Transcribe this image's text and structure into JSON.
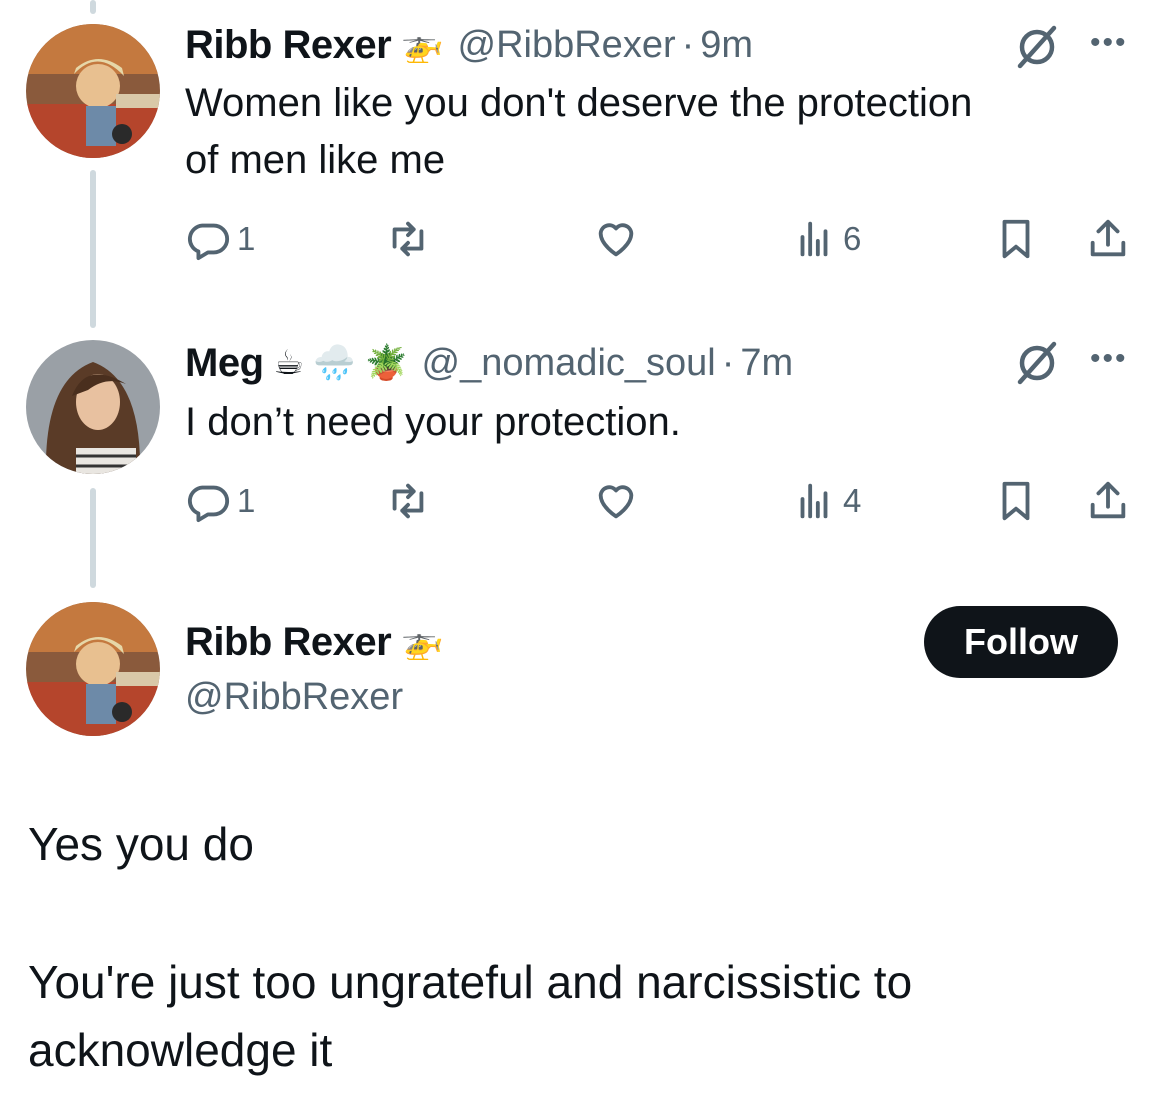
{
  "tweets": [
    {
      "name": "Ribb Rexer",
      "emoji": "🚁",
      "handle": "@RibbRexer",
      "separator": "·",
      "time": "9m",
      "text_lines": [
        "Women like you don't deserve the protection",
        "of men like me"
      ],
      "replies": "1",
      "views": "6"
    },
    {
      "name": "Meg",
      "emoji": "☕ 🌧️ 🪴",
      "handle": "@_nomadic_soul",
      "separator": "·",
      "time": "7m",
      "text_lines": [
        "I don’t need your protection."
      ],
      "replies": "1",
      "views": "4"
    }
  ],
  "main_tweet": {
    "name": "Ribb Rexer",
    "emoji": "🚁",
    "handle": "@RibbRexer",
    "follow_label": "Follow",
    "paragraphs": [
      "Yes you do",
      "You're just too ungrateful and narcissistic to",
      "acknowledge it"
    ]
  },
  "icons": {
    "grok": "grok-icon",
    "more": "more-icon",
    "reply": "reply-icon",
    "retweet": "retweet-icon",
    "like": "like-icon",
    "views": "views-icon",
    "bookmark": "bookmark-icon",
    "share": "share-icon"
  },
  "more_glyph": "•••",
  "colors": {
    "text": "#0f1419",
    "secondary": "#536471",
    "line": "#cfd9de",
    "follow_bg": "#0f1419"
  }
}
